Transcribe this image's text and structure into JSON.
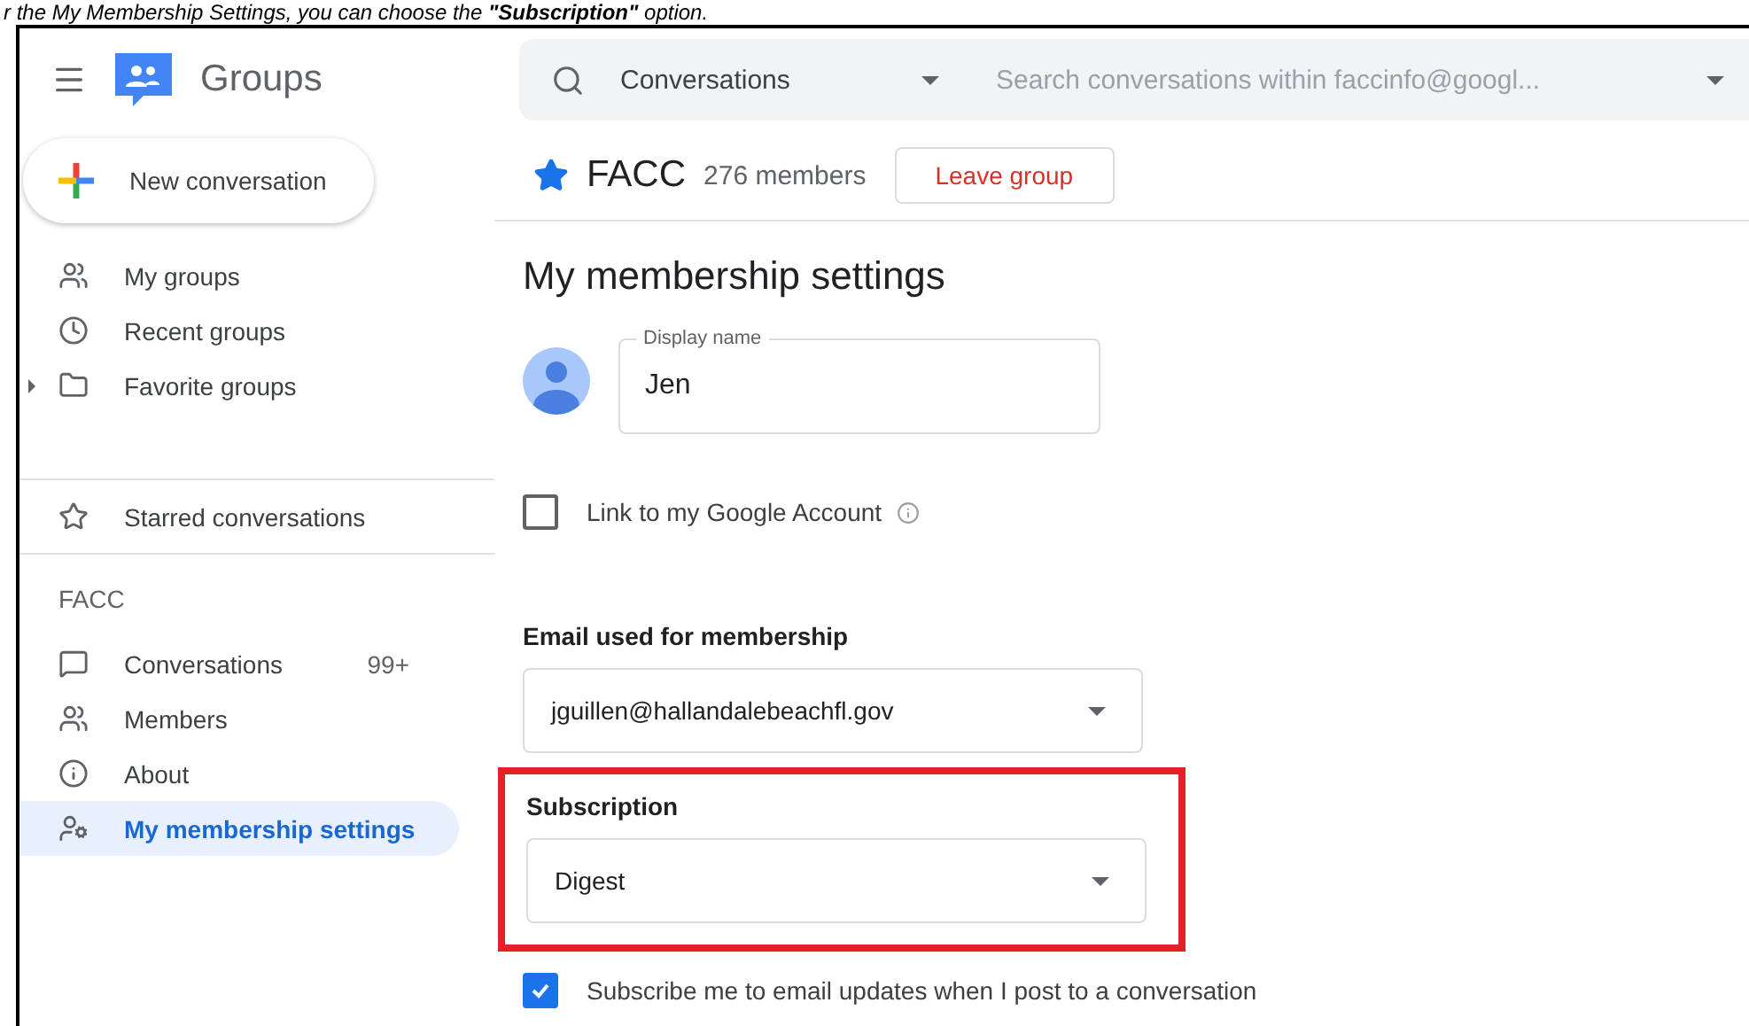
{
  "caption": "r the My Membership Settings, you can choose the **\"Subscription\"** option.",
  "app": {
    "name": "Groups"
  },
  "search": {
    "scope": "Conversations",
    "placeholder": "Search conversations within faccinfo@googl..."
  },
  "new_conversation": "New conversation",
  "nav": [
    {
      "label": "My groups",
      "expandable": false
    },
    {
      "label": "Recent groups",
      "expandable": false
    },
    {
      "label": "Favorite groups",
      "expandable": true
    }
  ],
  "starred": "Starred conversations",
  "group_section": {
    "title": "FACC",
    "items": [
      {
        "label": "Conversations",
        "count": "99+",
        "selected": false
      },
      {
        "label": "Members",
        "selected": false
      },
      {
        "label": "About",
        "selected": false
      },
      {
        "label": "My membership settings",
        "selected": true
      }
    ]
  },
  "group": {
    "name": "FACC",
    "starred": true,
    "members": "276 members",
    "leave": "Leave group"
  },
  "settings": {
    "title": "My membership settings",
    "display_name": {
      "label": "Display name",
      "value": "Jen"
    },
    "link_account": {
      "label": "Link to my Google Account",
      "checked": false
    },
    "email": {
      "label": "Email used for membership",
      "value": "jguillen@hallandalebeachfl.gov"
    },
    "subscription": {
      "label": "Subscription",
      "value": "Digest",
      "highlighted": true
    },
    "subscribe_updates": {
      "label": "Subscribe me to email updates when I post to a conversation",
      "checked": true
    }
  }
}
